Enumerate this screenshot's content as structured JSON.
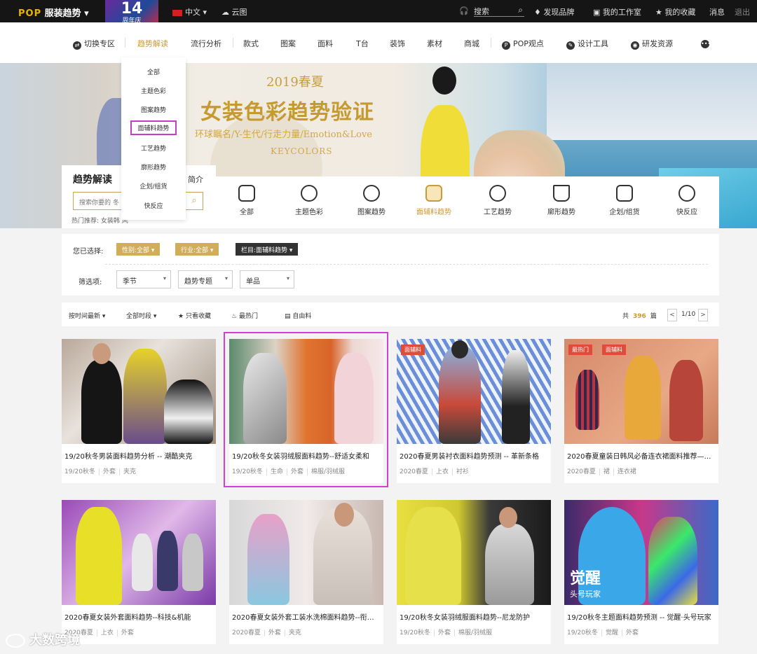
{
  "topbar": {
    "brand": "服装趋势",
    "brand_prefix": "POP",
    "anniversary_num": "14",
    "anniversary_text": "周年庆",
    "lang": "中文",
    "cloud": "云图",
    "search": "搜索",
    "discover": "发现品牌",
    "workspace": "我的工作室",
    "favorites": "我的收藏",
    "messages": "消息",
    "logout": "退出"
  },
  "nav": {
    "items": [
      "切换专区",
      "趋势解读",
      "流行分析",
      "款式",
      "图案",
      "面料",
      "T台",
      "装饰",
      "素材",
      "商城",
      "POP观点",
      "设计工具",
      "研发资源"
    ]
  },
  "dropdown": {
    "items": [
      "全部",
      "主题色彩",
      "图案趋势",
      "面辅料趋势",
      "工艺趋势",
      "廓形趋势",
      "企划/组货",
      "快反应"
    ]
  },
  "banner": {
    "season": "2019春夏",
    "title": "女装色彩趋势验证",
    "subtitle": "环球瞩名/Y-生代/行走力量/Emotion&Love",
    "tag": "KEYCOLORS"
  },
  "panel": {
    "title": "趋势解读",
    "intro": "简介",
    "search_placeholder": "搜索你要的 冬",
    "hot": "热门推荐: 女装韩 风"
  },
  "categories": [
    "全部",
    "主题色彩",
    "图案趋势",
    "面辅料趋势",
    "工艺趋势",
    "廓形趋势",
    "企划/组货",
    "快反应"
  ],
  "filters": {
    "selected_label": "您已选择:",
    "chips": [
      "性别:全部",
      "行业:全部",
      "栏目:面辅料趋势"
    ],
    "filter_label": "筛选项:",
    "selects": [
      "季节",
      "趋势专题",
      "单品"
    ]
  },
  "sort": {
    "latest": "按时间最新",
    "all_time": "全部时段",
    "fav_only": "只看收藏",
    "hottest": "最热门",
    "own": "自由料",
    "total_prefix": "共",
    "total": "396",
    "total_suffix": "篇",
    "page": "1/10",
    "prev": "<",
    "next": ">"
  },
  "cards": [
    {
      "title": "19/20秋冬男装面料趋势分析 -- 潮酷夹克",
      "tags": [
        "19/20秋冬",
        "外套",
        "夹克"
      ],
      "badges": []
    },
    {
      "title": "19/20秋冬女装羽绒服面料趋势--舒适女柔和",
      "tags": [
        "19/20秋冬",
        "生命",
        "外套",
        "棉服/羽绒服"
      ],
      "badges": []
    },
    {
      "title": "2020春夏男装衬衣面料趋势预测 -- 革新条格",
      "tags": [
        "2020春夏",
        "上衣",
        "衬衫"
      ],
      "badges": [
        "面辅料"
      ]
    },
    {
      "title": "2020春夏童装日韩风必备连衣裙面料推荐—…",
      "tags": [
        "2020春夏",
        "裙",
        "连衣裙"
      ],
      "badges": [
        "最热门",
        "面辅料"
      ]
    },
    {
      "title": "2020春夏女装外套面料趋势--科技&机能",
      "tags": [
        "2020春夏",
        "上衣",
        "外套"
      ],
      "badges": []
    },
    {
      "title": "2020春夏女装外套工装水洗棉面料趋势--衔…",
      "tags": [
        "2020春夏",
        "外套",
        "夹克"
      ],
      "badges": []
    },
    {
      "title": "19/20秋冬女装羽绒服面料趋势--尼龙防护",
      "tags": [
        "19/20秋冬",
        "外套",
        "棉服/羽绒服"
      ],
      "badges": []
    },
    {
      "title": "19/20秋冬主题面料趋势预测 -- 觉醒·头号玩家",
      "tags": [
        "19/20秋冬",
        "觉醒",
        "外套"
      ],
      "badges": [],
      "overlay": "觉醒",
      "overlay_sub": "头号玩家"
    }
  ],
  "watermark": "大数跨境"
}
